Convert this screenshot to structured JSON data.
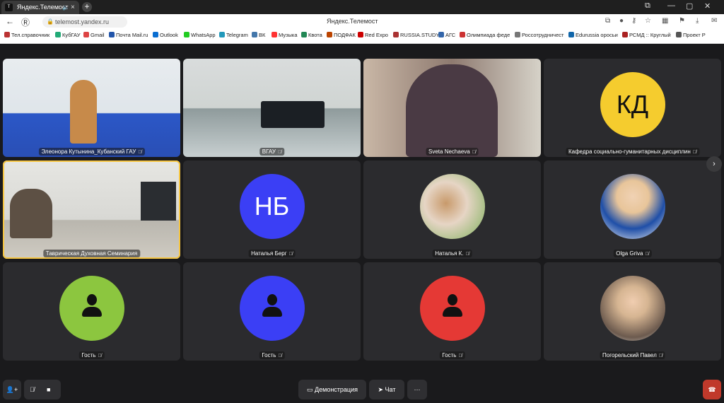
{
  "browser": {
    "tab_title": "Яндекс.Телемост",
    "tab_icon": "telemost-logo-icon",
    "url": "telemost.yandex.ru",
    "page_title": "Яндекс.Телемост",
    "bookmarks": [
      "Тел.справочник",
      "КубГАУ",
      "Gmail",
      "Почта Mail.ru",
      "Outlook",
      "WhatsApp",
      "Telegram",
      "ВК",
      "Музыка",
      "Квота",
      "ПОДФАК",
      "Red Expo",
      "RUSSIA.STUDY",
      "АГС",
      "Олимпиада феде",
      "Россотрудничест",
      "Edurussia оросьи",
      "РСМД :: Круглый",
      "Проект Р"
    ]
  },
  "participants": [
    {
      "name": "Элеонора Кутынина_Кубанский ГАУ",
      "kind": "video"
    },
    {
      "name": "ВГАУ",
      "kind": "video"
    },
    {
      "name": "Sveta Nechaeva",
      "kind": "video"
    },
    {
      "name": "Кафедра социально-гуманитарных дисциплин",
      "kind": "initials",
      "initials": "КД",
      "color": "#f5cc2e"
    },
    {
      "name": "Таврическая Духовная Семинария",
      "kind": "video",
      "active": true
    },
    {
      "name": "Наталья Берг",
      "kind": "initials",
      "initials": "НБ",
      "color": "#3b3ff5"
    },
    {
      "name": "Наталья К.",
      "kind": "photo"
    },
    {
      "name": "Olga Griva",
      "kind": "photo"
    },
    {
      "name": "Гость",
      "kind": "guest",
      "color": "#8cc63f"
    },
    {
      "name": "Гость",
      "kind": "guest",
      "color": "#3b3ff5"
    },
    {
      "name": "Гость",
      "kind": "guest",
      "color": "#e53935"
    },
    {
      "name": "Погорельский Павел",
      "kind": "photo"
    }
  ],
  "toolbar": {
    "screen_share_label": "Демонстрация",
    "chat_label": "Чат",
    "more_label": "···"
  }
}
